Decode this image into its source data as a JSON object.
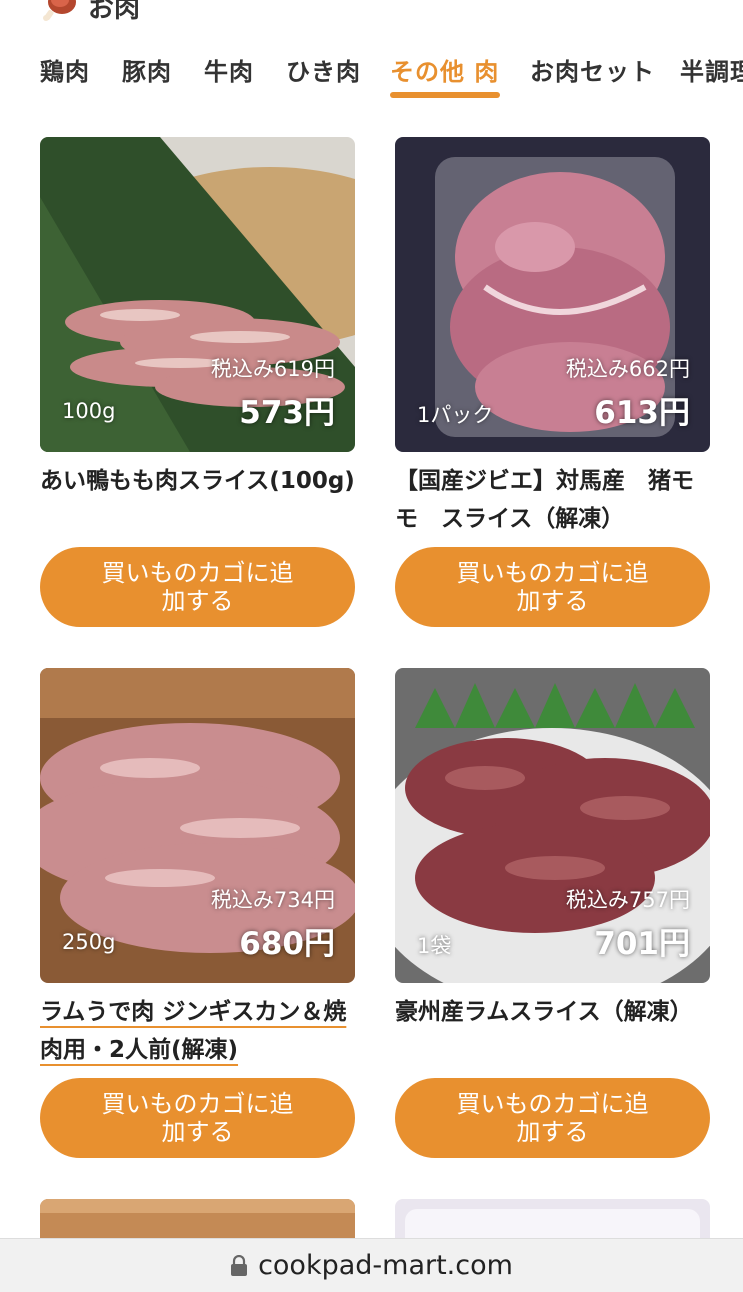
{
  "header": {
    "title": "お肉",
    "icon": "meat-icon"
  },
  "tabs": [
    {
      "label": "鶏肉",
      "active": false
    },
    {
      "label": "豚肉",
      "active": false
    },
    {
      "label": "牛肉",
      "active": false
    },
    {
      "label": "ひき肉",
      "active": false
    },
    {
      "label": "その他 肉",
      "active": true
    },
    {
      "label": "お肉セット",
      "active": false
    },
    {
      "label": "半調理",
      "active": false
    }
  ],
  "products": [
    {
      "name": "あい鴨もも肉スライス(100g)",
      "tax_price": "税込み619円",
      "price": "573円",
      "amount": "100g",
      "button": "買いものカゴに追加する"
    },
    {
      "name": "【国産ジビエ】対馬産　猪モモ　スライス（解凍）",
      "tax_price": "税込み662円",
      "price": "613円",
      "amount": "1パック",
      "button": "買いものカゴに追加する"
    },
    {
      "name": "ラムうで肉 ジンギスカン＆焼肉用・2人前(解凍)",
      "tax_price": "税込み734円",
      "price": "680円",
      "amount": "250g",
      "button": "買いものカゴに追加する"
    },
    {
      "name": "豪州産ラムスライス（解凍）",
      "tax_price": "税込み757円",
      "price": "701円",
      "amount": "1袋",
      "button": "買いものカゴに追加する"
    }
  ],
  "browser": {
    "url": "cookpad-mart.com",
    "lock_icon": "lock-icon"
  },
  "colors": {
    "accent": "#e8902f",
    "text": "#222222"
  }
}
